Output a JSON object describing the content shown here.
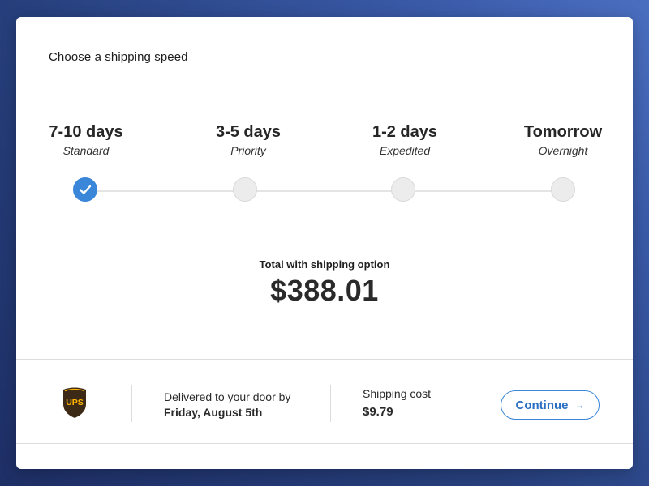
{
  "heading": "Choose a shipping speed",
  "speeds": [
    {
      "days": "7-10 days",
      "name": "Standard",
      "selected": true
    },
    {
      "days": "3-5 days",
      "name": "Priority",
      "selected": false
    },
    {
      "days": "1-2 days",
      "name": "Expedited",
      "selected": false
    },
    {
      "days": "Tomorrow",
      "name": "Overnight",
      "selected": false
    }
  ],
  "total": {
    "label": "Total with shipping option",
    "value": "$388.01"
  },
  "footer": {
    "carrier_icon": "ups-logo-icon",
    "delivery_label": "Delivered to your door by",
    "delivery_date": "Friday, August 5th",
    "cost_label": "Shipping cost",
    "cost_value": "$9.79",
    "continue_label": "Continue",
    "continue_arrow": "→"
  },
  "colors": {
    "accent": "#3a86d8",
    "background_start": "#1e2f66",
    "background_end": "#4b6fc0",
    "ups_brown": "#3d2a16",
    "ups_gold": "#ffb500"
  }
}
